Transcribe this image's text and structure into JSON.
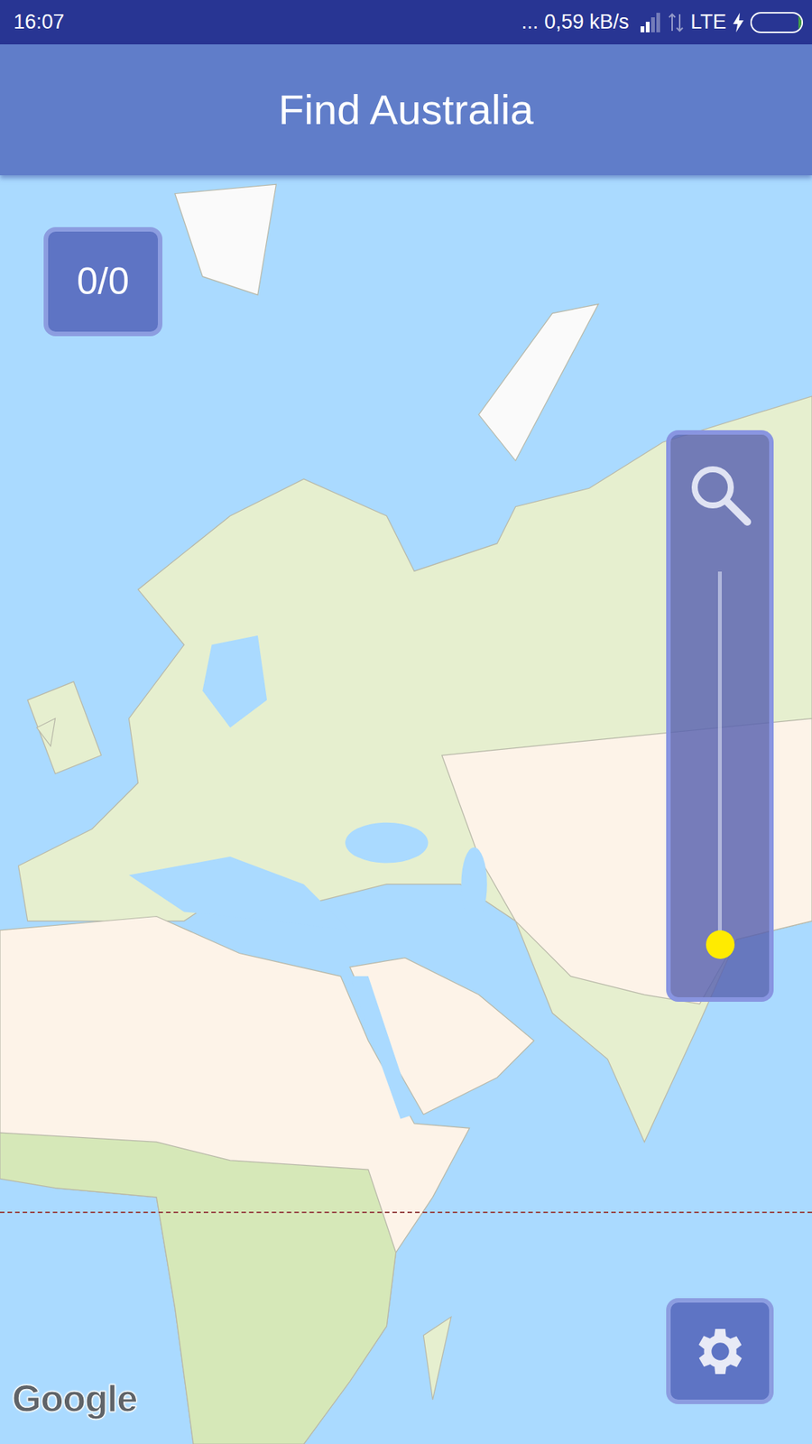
{
  "status_bar": {
    "time": "16:07",
    "dots": "...",
    "speed": "0,59 kB/s",
    "network": "LTE",
    "signal": {
      "level": 0.5
    },
    "battery": {
      "level": 0.06,
      "charging": true
    }
  },
  "app_bar": {
    "title": "Find Australia"
  },
  "score": "0/0",
  "zoom": {
    "level": 0
  },
  "map": {
    "attribution": "Google"
  }
}
